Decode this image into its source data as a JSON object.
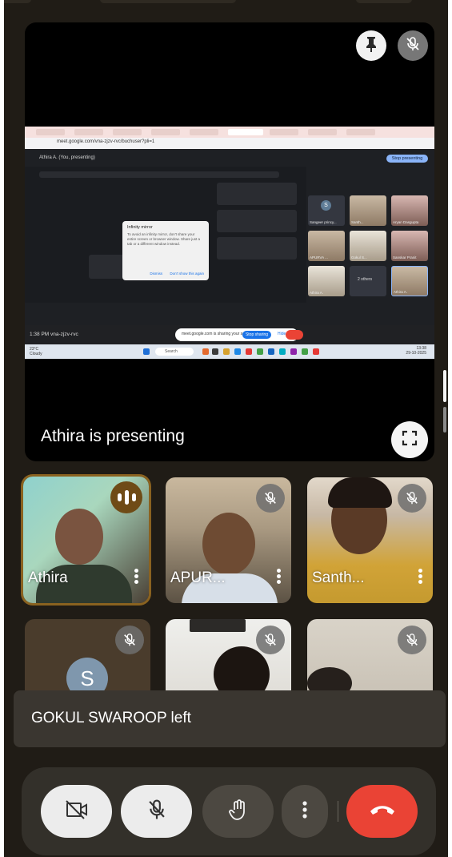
{
  "presentation": {
    "presenting_text": "Athira is presenting",
    "shared_screen": {
      "url": "meet.google.com/vna-zjzv-rvc/buchuser?pli=1",
      "meet_title": "Athira A. (You, presenting)",
      "stop_presenting": "Stop presenting",
      "dialog_title": "Infinity mirror",
      "dialog_body": "To avoid an infinity mirror, don't share your entire screen or browser window. Share just a tab or a different window instead.",
      "dialog_dismiss": "Dismiss",
      "dialog_dont_show": "Don't show this again",
      "grid": [
        {
          "label": "Sangeer princy...",
          "initial": "S"
        },
        {
          "label": "Santh..."
        },
        {
          "label": "Aryan Dasgupta"
        },
        {
          "label": "APURVA ..."
        },
        {
          "label": "Gokul S..."
        },
        {
          "label": "Sanskar Pranit"
        },
        {
          "label": "Athira A."
        },
        {
          "label": "2 others"
        },
        {
          "label": "Athira A."
        }
      ],
      "meeting_time": "1:38 PM",
      "meeting_code": "vna-zjzv-rvc",
      "share_notice": "meet.google.com is sharing your screen.",
      "share_stop": "Stop sharing",
      "share_hide": "Hide",
      "taskbar_search": "Search",
      "weather": "23°C",
      "weather_sub": "Cloudy",
      "tray_lang": "ENG",
      "tray_region": "IN",
      "clock_time": "13:38",
      "clock_date": "29-10-2025"
    }
  },
  "participants": [
    {
      "name": "Athira",
      "speaking": true
    },
    {
      "name": "APUR...",
      "muted": true
    },
    {
      "name": "Santh...",
      "muted": true
    },
    {
      "initial": "S",
      "muted": true
    },
    {
      "muted": true
    },
    {
      "muted": true
    }
  ],
  "toast": {
    "text": "GOKUL SWAROOP left"
  },
  "icons": {
    "pin": "pin-icon",
    "mic_off": "mic-off-icon",
    "fullscreen": "fullscreen-icon",
    "camera_off": "camera-off-icon",
    "raise_hand": "hand-icon",
    "more": "more-vert-icon",
    "end_call": "end-call-icon",
    "speaking": "audio-level-icon"
  },
  "colors": {
    "background": "#201c16",
    "end_call": "#ea4335",
    "control_light": "#ececec",
    "control_dark": "#4c4841",
    "speaking_border": "#8a6220"
  }
}
